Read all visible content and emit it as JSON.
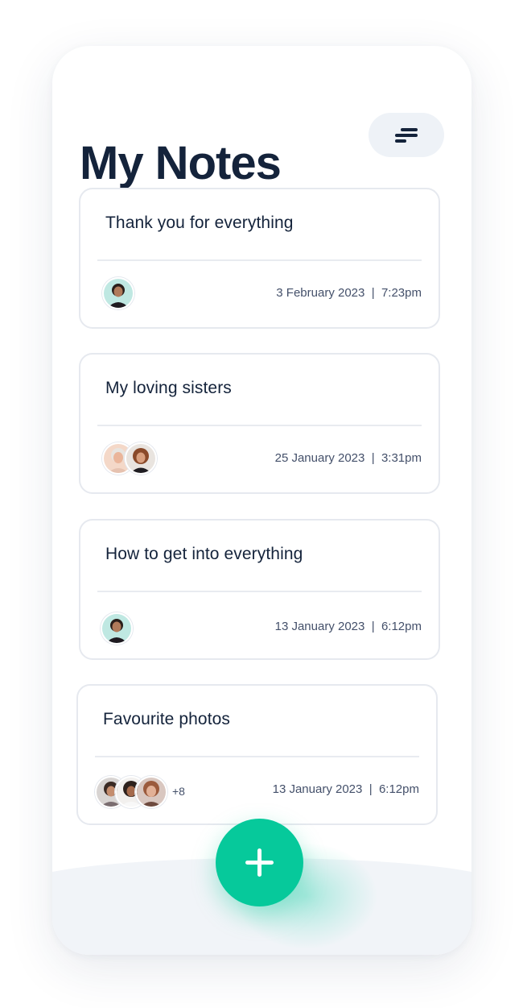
{
  "header": {
    "title": "My Notes",
    "filter_icon": "sort-lines-icon"
  },
  "notes": [
    {
      "title": "Thank you for everything",
      "date": "3 February 2023",
      "time": "7:23pm",
      "avatar_count": 1,
      "extra": ""
    },
    {
      "title": "My loving sisters",
      "date": "25 January 2023",
      "time": "3:31pm",
      "avatar_count": 2,
      "extra": ""
    },
    {
      "title": "How to get into everything",
      "date": "13 January 2023",
      "time": "6:12pm",
      "avatar_count": 1,
      "extra": ""
    },
    {
      "title": "Favourite photos",
      "date": "13 January 2023",
      "time": "6:12pm",
      "avatar_count": 3,
      "extra": "+8"
    }
  ],
  "fab": {
    "icon": "plus-icon"
  },
  "colors": {
    "accent": "#06c99b",
    "title": "#14233b",
    "meta": "#44506a",
    "card_border": "#e6e9ef"
  }
}
